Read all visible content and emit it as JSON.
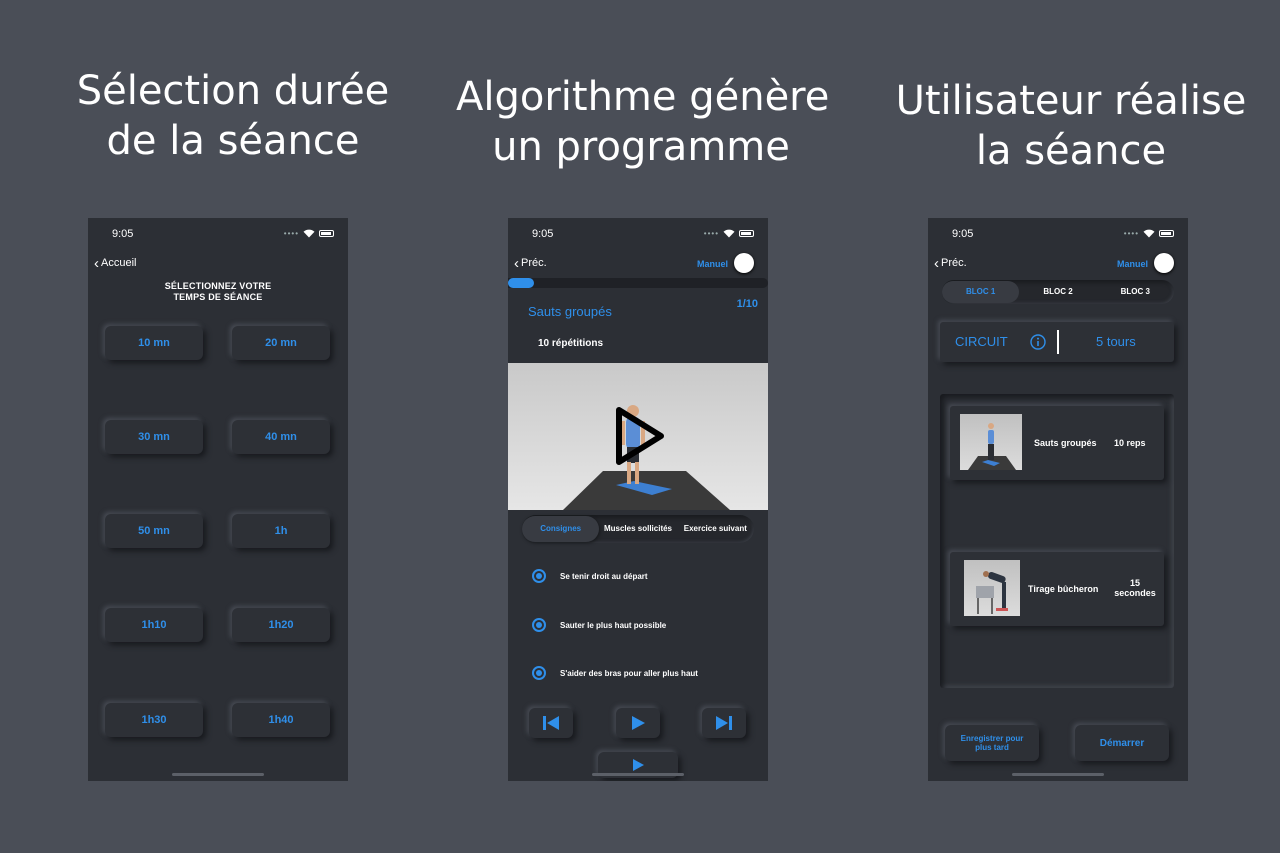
{
  "captions": {
    "step1": [
      "Sélection durée",
      "de la séance"
    ],
    "step2": [
      "Algorithme génère",
      "un programme"
    ],
    "step3": [
      "Utilisateur réalise",
      "la séance"
    ]
  },
  "status": {
    "time": "9:05"
  },
  "screen1": {
    "back_label": "Accueil",
    "title_line1": "SÉLECTIONNEZ VOTRE",
    "title_line2": "TEMPS DE SÉANCE",
    "durations": [
      "10 mn",
      "20 mn",
      "30 mn",
      "40 mn",
      "50 mn",
      "1h",
      "1h10",
      "1h20",
      "1h30",
      "1h40"
    ]
  },
  "screen2": {
    "back_label": "Préc.",
    "manual_label": "Manuel",
    "progress": 0.1,
    "exercise_name": "Sauts groupés",
    "exercise_counter": "1/10",
    "repetitions": "10 répétitions",
    "tabs": [
      "Consignes",
      "Muscles sollicités",
      "Exercice suivant"
    ],
    "active_tab": "Consignes",
    "instructions": [
      "Se tenir droit au départ",
      "Sauter le plus haut possible",
      "S'aider des bras pour aller plus haut"
    ],
    "controls": [
      "previous-icon",
      "play-icon",
      "next-icon",
      "play-icon"
    ]
  },
  "screen3": {
    "back_label": "Préc.",
    "manual_label": "Manuel",
    "blocks": [
      "BLOC 1",
      "BLOC 2",
      "BLOC 3"
    ],
    "active_block": "BLOC 1",
    "circuit_label": "CIRCUIT",
    "rounds": "5 tours",
    "exercises": [
      {
        "name": "Sauts groupés",
        "amount_line1": "10 reps",
        "amount_line2": ""
      },
      {
        "name": "Tirage bûcheron",
        "amount_line1": "15",
        "amount_line2": "secondes"
      }
    ],
    "save_label_line1": "Enregistrer pour",
    "save_label_line2": "plus tard",
    "start_label": "Démarrer"
  },
  "colors": {
    "background": "#4a4e57",
    "phone": "#2c2f35",
    "accent": "#2f8fea"
  }
}
